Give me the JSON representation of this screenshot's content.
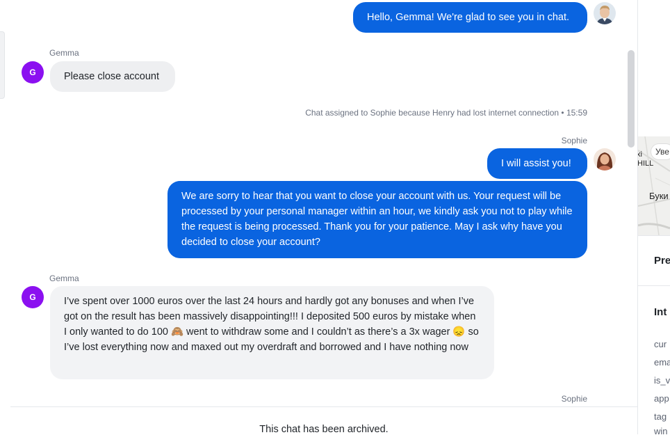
{
  "messages": {
    "m1": "Hello, Gemma! We're glad to see you in chat.",
    "m2_author": "Gemma",
    "m2": "Please close account",
    "system": "Chat assigned to Sophie because Henry had lost internet connection • 15:59",
    "m3_author": "Sophie",
    "m3": "I will assist you!",
    "m4": "We are sorry to hear that you want to close your account with us. Your request will be processed by your personal manager within an hour, we kindly ask you not to play while the request is being processed. Thank you for your patience. May I ask why have you decided to close your account?",
    "m5_author": "Gemma",
    "m5": "I’ve spent over 1000 euros over the last 24 hours and hardly got any bonuses and when I’ve got on the result has been massively disappointing!!! I deposited 500 euros by mistake when I only wanted to do 100 🙈 went to withdraw some and I couldn’t as there’s a 3x wager 😞 so I’ve lost everything now and maxed out my overdraft and borrowed and I have nothing now",
    "m6_author": "Sophie"
  },
  "avatars": {
    "customer_initial": "G",
    "customer_color": "#8b10f0",
    "agent_color": "#0a64e0"
  },
  "footer": {
    "archived": "This chat has been archived."
  },
  "right_panel": {
    "map_notice": "Уве",
    "map_label_1": "хі",
    "map_label_2": "HILL",
    "map_label_3": "Буки",
    "section_1": "Pre",
    "section_2": "Int",
    "keys": [
      "cur",
      "ema",
      "is_v",
      "app",
      "tag",
      "win"
    ]
  }
}
